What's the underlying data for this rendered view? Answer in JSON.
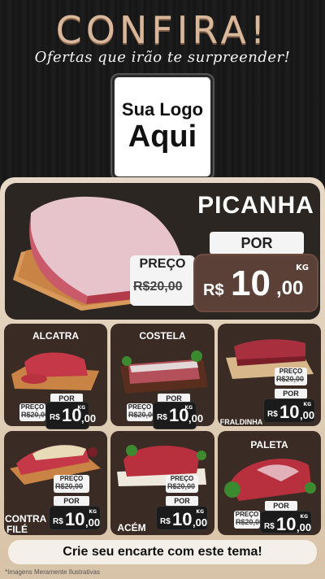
{
  "header": {
    "title": "CONFIRA!",
    "subtitle": "Ofertas que irão te surpreender!"
  },
  "logo": {
    "line1": "Sua Logo",
    "line2": "Aqui"
  },
  "hero": {
    "name": "PICANHA",
    "por": "POR",
    "preco": "PREÇO",
    "old_price": "R$20,00",
    "currency": "R$",
    "price_int": "10",
    "price_dec": ",00",
    "unit": "KG"
  },
  "products": [
    {
      "name": "ALCATRA",
      "preco": "PREÇO",
      "old": "R$20,00",
      "por": "POR",
      "currency": "R$",
      "int": "10",
      "dec": ",00",
      "unit": "KG"
    },
    {
      "name": "COSTELA",
      "preco": "PREÇO",
      "old": "R$20,00",
      "por": "POR",
      "currency": "R$",
      "int": "10",
      "dec": ",00",
      "unit": "KG"
    },
    {
      "name": "FRALDINHA",
      "preco": "PREÇO",
      "old": "R$20,00",
      "por": "POR",
      "currency": "R$",
      "int": "10",
      "dec": ",00",
      "unit": "KG"
    },
    {
      "name_l1": "CONTRA",
      "name_l2": "FILÉ",
      "preco": "PREÇO",
      "old": "R$20,00",
      "por": "POR",
      "currency": "R$",
      "int": "10",
      "dec": ",00",
      "unit": "KG"
    },
    {
      "name": "ACÉM",
      "preco": "PREÇO",
      "old": "R$20,00",
      "por": "POR",
      "currency": "R$",
      "int": "10",
      "dec": ",00",
      "unit": "KG"
    },
    {
      "name": "PALETA",
      "preco": "PREÇO",
      "old": "R$20,00",
      "por": "POR",
      "currency": "R$",
      "int": "10",
      "dec": ",00",
      "unit": "KG"
    }
  ],
  "cta": "Crie seu encarte com este tema!",
  "footnote": "*Imagens Meramente Ilustrativas",
  "colors": {
    "accent": "#d9b79a",
    "card": "#3b2b25",
    "panel": "#e8d9c6",
    "price_bg": "#5a4036"
  }
}
